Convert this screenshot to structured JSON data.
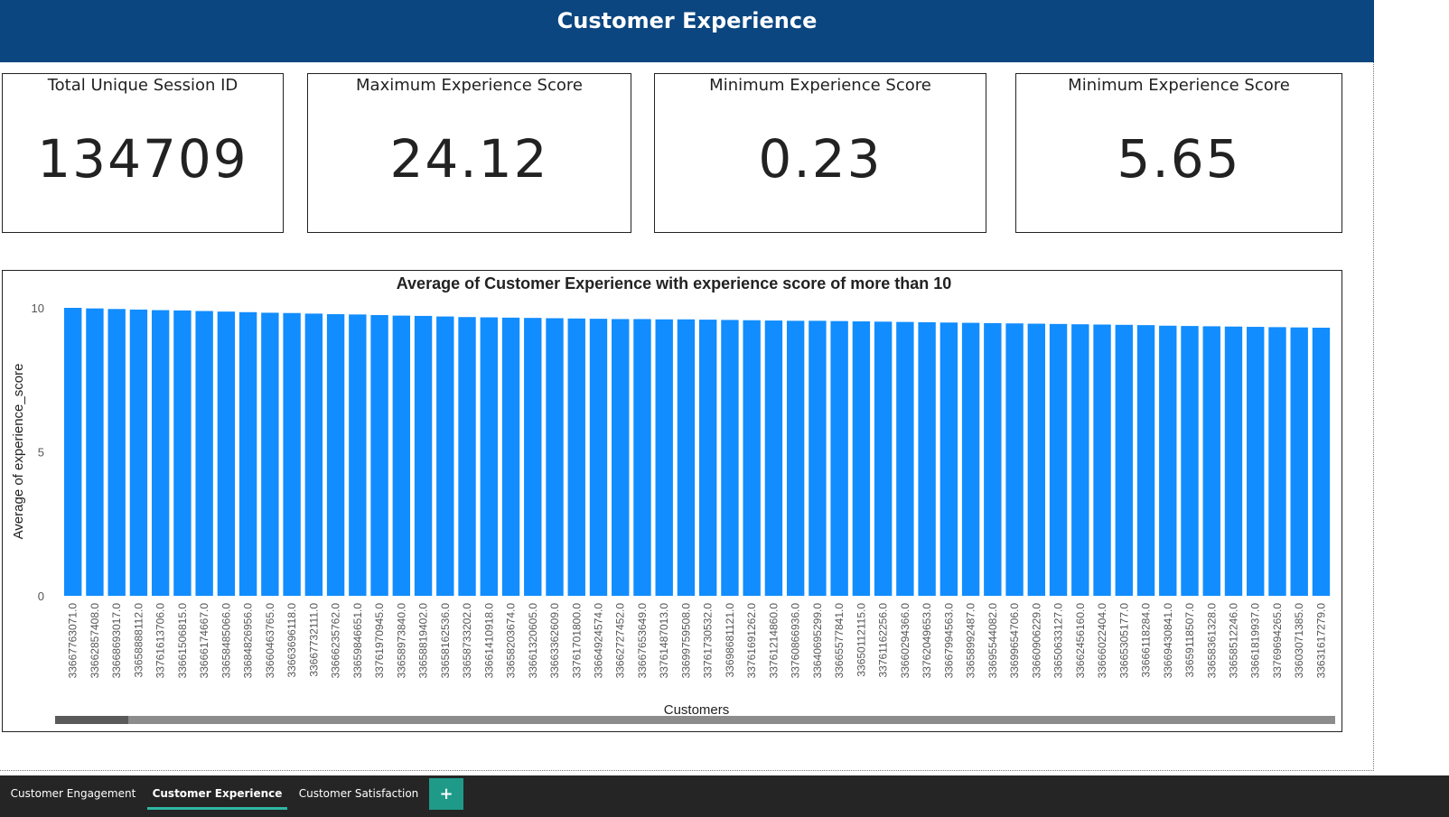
{
  "report": {
    "title": "Customer Experience"
  },
  "cards": [
    {
      "title": "Total Unique Session ID",
      "value": "134709"
    },
    {
      "title": "Maximum Experience Score",
      "value": "24.12"
    },
    {
      "title": "Minimum Experience Score",
      "value": "0.23"
    },
    {
      "title": "Minimum Experience Score",
      "value": "5.65"
    }
  ],
  "chart_data": {
    "type": "bar",
    "title": "Average of Customer Experience with experience score of more than 10",
    "xlabel": "Customers",
    "ylabel": "Average of experience_score",
    "ylim": [
      0,
      10
    ],
    "yticks": [
      0,
      5,
      10
    ],
    "grid": false,
    "bar_color": "#118dff",
    "categories": [
      "33667763071.0",
      "33662857408.0",
      "33668693017.0",
      "33658888112.0",
      "33761613706.0",
      "33661506815.0",
      "33666174667.0",
      "33658485066.0",
      "33684826956.0",
      "33660463765.0",
      "33663696118.0",
      "33667732111.0",
      "33666235762.0",
      "33659846651.0",
      "33761970945.0",
      "33658973840.0",
      "33658819402.0",
      "33658162536.0",
      "33658733202.0",
      "33661410918.0",
      "33658203674.0",
      "33661320605.0",
      "33663362609.0",
      "33761701800.0",
      "33664924574.0",
      "33662727452.0",
      "33667653649.0",
      "33761487013.0",
      "33699759508.0",
      "33761730532.0",
      "33698681121.0",
      "33761691262.0",
      "33761214860.0",
      "33760866936.0",
      "33640695299.0",
      "33665577841.0",
      "33650112115.0",
      "33761162256.0",
      "33660294366.0",
      "33762049653.0",
      "33667994563.0",
      "33658992487.0",
      "33695544082.0",
      "33699654706.0",
      "33660906229.0",
      "33650633127.0",
      "33662456160.0",
      "33666022404.0",
      "33665305177.0",
      "33666118284.0",
      "33669430841.0",
      "33659118507.0",
      "33658361328.0",
      "33658512246.0",
      "33661819937.0",
      "33769694265.0",
      "33603071385.0",
      "33631617279.0"
    ],
    "values": [
      10.0,
      9.98,
      9.96,
      9.94,
      9.92,
      9.91,
      9.89,
      9.87,
      9.85,
      9.83,
      9.82,
      9.8,
      9.78,
      9.77,
      9.75,
      9.73,
      9.72,
      9.7,
      9.68,
      9.67,
      9.66,
      9.65,
      9.64,
      9.63,
      9.62,
      9.61,
      9.61,
      9.6,
      9.6,
      9.59,
      9.58,
      9.57,
      9.56,
      9.55,
      9.55,
      9.54,
      9.53,
      9.52,
      9.51,
      9.5,
      9.49,
      9.48,
      9.47,
      9.46,
      9.45,
      9.44,
      9.43,
      9.42,
      9.41,
      9.4,
      9.38,
      9.37,
      9.36,
      9.35,
      9.34,
      9.33,
      9.32,
      9.31
    ]
  },
  "tabs": [
    {
      "label": "Customer Engagement",
      "active": false
    },
    {
      "label": "Customer Experience",
      "active": true
    },
    {
      "label": "Customer Satisfaction",
      "active": false
    }
  ],
  "add_tab_label": "+"
}
